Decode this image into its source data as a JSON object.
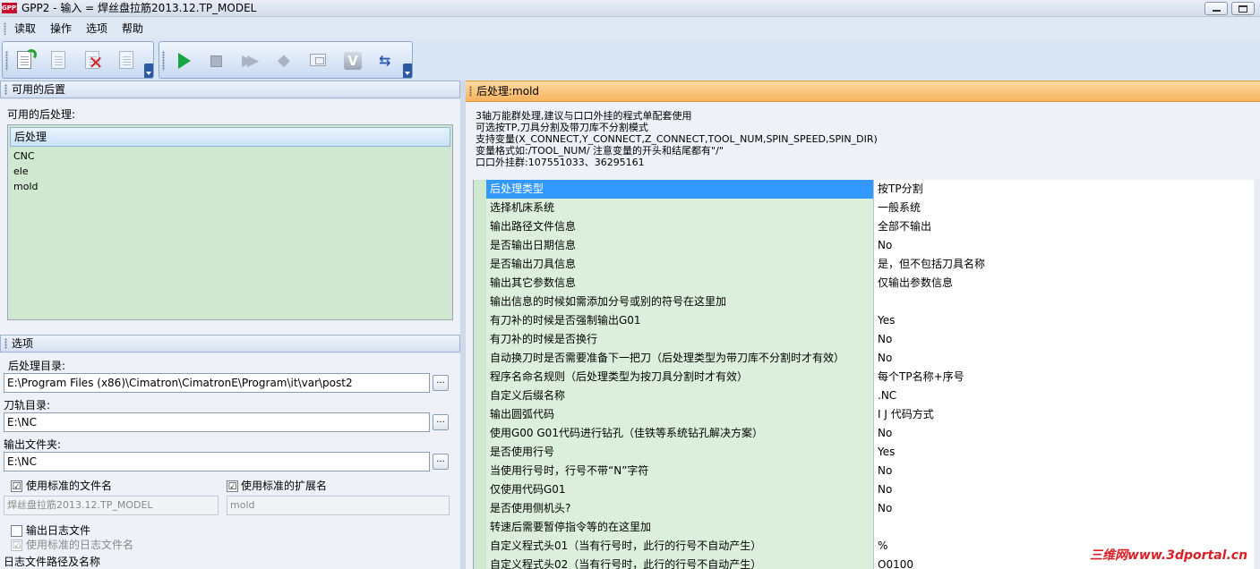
{
  "window": {
    "logo_text": "GPP2",
    "title": "GPP2 - 输入 = 焊丝盘拉筋2013.12.TP_MODEL"
  },
  "menu": [
    "读取",
    "操作",
    "选项",
    "帮助"
  ],
  "toolbar": {
    "group1": [
      "edit-postprocessor-icon",
      "edit-disabled-icon",
      "delete-postprocessor-icon",
      "gpp-info-icon"
    ],
    "group2": [
      "run-icon",
      "stop-icon",
      "fast-forward-icon",
      "step-icon",
      "window-icon",
      "verify-icon",
      "swap-icon"
    ]
  },
  "available_panel": {
    "header": "可用的后置",
    "label": "可用的后处理:",
    "list_header": "后处理",
    "items": [
      "CNC",
      "ele",
      "mold"
    ]
  },
  "options_panel": {
    "header": "选项",
    "post_dir_label": "后处理目录:",
    "post_dir_value": "E:\\Program Files (x86)\\Cimatron\\CimatronE\\Program\\it\\var\\post2",
    "toolpath_dir_label": "刀轨目录:",
    "toolpath_dir_value": "E:\\NC",
    "output_dir_label": "输出文件夹:",
    "output_dir_value": "E:\\NC",
    "browse_label": "...",
    "use_std_filename": "使用标准的文件名",
    "use_std_ext": "使用标准的扩展名",
    "filename_value": "焊丝盘拉筋2013.12.TP_MODEL",
    "ext_value": "mold",
    "output_log": "输出日志文件",
    "use_std_log_name": "使用标准的日志文件名",
    "log_path_label": "日志文件路径及名称",
    "checkmark": "☑"
  },
  "post_panel": {
    "header": "后处理:mold",
    "description": [
      "3轴万能群处理,建议与口口外挂的程式单配套使用",
      "可选按TP,刀具分割及带刀库不分割模式",
      "支持变量(X_CONNECT,Y_CONNECT,Z_CONNECT,TOOL_NUM,SPIN_SPEED,SPIN_DIR)",
      "变量格式如:/TOOL_NUM/ 注意变量的开头和结尾都有\"/\"",
      "口口外挂群:107551033、36295161"
    ],
    "properties": [
      {
        "name": "后处理类型",
        "value": "按TP分割",
        "dropdown": true
      },
      {
        "name": "选择机床系统",
        "value": "一般系统",
        "dropdown": true
      },
      {
        "name": "输出路径文件信息",
        "value": "全部不输出",
        "dropdown": true
      },
      {
        "name": "是否输出日期信息",
        "value": "No",
        "dropdown": true
      },
      {
        "name": "是否输出刀具信息",
        "value": "是，但不包括刀具名称",
        "dropdown": true
      },
      {
        "name": "输出其它参数信息",
        "value": "仅输出参数信息",
        "dropdown": true
      },
      {
        "name": "输出信息的时候如需添加分号或别的符号在这里加",
        "value": "",
        "dropdown": false
      },
      {
        "name": "有刀补的时候是否强制输出G01",
        "value": "Yes",
        "dropdown": true
      },
      {
        "name": "有刀补的时候是否换行",
        "value": "No",
        "dropdown": true
      },
      {
        "name": "自动换刀时是否需要准备下一把刀（后处理类型为带刀库不分割时才有效）",
        "value": "No",
        "dropdown": true
      },
      {
        "name": "程序名命名规则（后处理类型为按刀具分割时才有效）",
        "value": "每个TP名称+序号",
        "dropdown": true
      },
      {
        "name": "自定义后缀名称",
        "value": ".NC",
        "dropdown": false
      },
      {
        "name": "输出圆弧代码",
        "value": "I J 代码方式",
        "dropdown": true
      },
      {
        "name": "使用G00 G01代码进行钻孔（佳铁等系统钻孔解决方案）",
        "value": "No",
        "dropdown": true
      },
      {
        "name": "是否使用行号",
        "value": "Yes",
        "dropdown": true
      },
      {
        "name": "当使用行号时，行号不带“N”字符",
        "value": "No",
        "dropdown": true
      },
      {
        "name": "仅使用代码G01",
        "value": "No",
        "dropdown": true
      },
      {
        "name": "是否使用侧机头?",
        "value": "No",
        "dropdown": true
      },
      {
        "name": "转速后需要暂停指令等的在这里加",
        "value": "",
        "dropdown": false
      },
      {
        "name": "自定义程式头01（当有行号时，此行的行号不自动产生）",
        "value": "%",
        "dropdown": false
      },
      {
        "name": "自定义程式头02（当有行号时，此行的行号不自动产生）",
        "value": "O0100",
        "dropdown": false
      }
    ]
  },
  "watermark": "三维网www.3dportal.cn"
}
